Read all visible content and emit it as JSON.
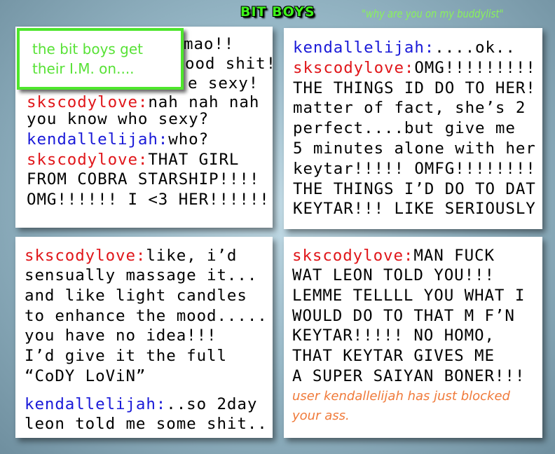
{
  "header": {
    "title": "BIT BOYS",
    "tagline": "\"why are you on my buddylist\""
  },
  "caption": {
    "line1": "the bit boys get",
    "line2": "their I.M. on...."
  },
  "panel1": {
    "partial": [
      "mao!!",
      "ood shit!",
      "e sexy!"
    ],
    "lines": [
      {
        "user": "skscodylove:",
        "text": "nah nah nah"
      },
      {
        "user": "",
        "text": "you know who sexy?"
      },
      {
        "user": "kendallelijah:",
        "text": "who?"
      },
      {
        "user": "skscodylove:",
        "text": "THAT GIRL"
      },
      {
        "user": "",
        "text": "FROM COBRA STARSHIP!!!!"
      },
      {
        "user": "",
        "text": "OMG!!!!!! I <3 HER!!!!!!"
      }
    ]
  },
  "panel2": {
    "lines": [
      {
        "user": "kendallelijah:",
        "text": "....ok.."
      },
      {
        "user": "skscodylove:",
        "text": "OMG!!!!!!!!!"
      },
      {
        "user": "",
        "text": "THE THINGS ID DO TO HER!"
      },
      {
        "user": "",
        "text": "matter of fact, she’s 2"
      },
      {
        "user": "",
        "text": "perfect....but give me"
      },
      {
        "user": "",
        "text": "5 minutes alone with her"
      },
      {
        "user": "",
        "text": "keytar!!!!! OMFG!!!!!!!!"
      },
      {
        "user": "",
        "text": "THE THINGS I’D DO TO DAT"
      },
      {
        "user": "",
        "text": "KEYTAR!!! LIKE SERIOUSLY"
      }
    ]
  },
  "panel3": {
    "lines": [
      {
        "user": "skscodylove:",
        "text": "like, i’d"
      },
      {
        "user": "",
        "text": "sensually massage it..."
      },
      {
        "user": "",
        "text": "and like light candles"
      },
      {
        "user": "",
        "text": "to enhance the mood....."
      },
      {
        "user": "",
        "text": "you have no idea!!!"
      },
      {
        "user": "",
        "text": "I’d give it the full"
      },
      {
        "user": "",
        "text": "“CoDY LoViN”"
      },
      {
        "user": "kendallelijah:",
        "text": "..so 2day"
      },
      {
        "user": "",
        "text": "leon told me some shit.."
      }
    ]
  },
  "panel4": {
    "lines": [
      {
        "user": "skscodylove:",
        "text": "MAN FUCK"
      },
      {
        "user": "",
        "text": "WAT LEON TOLD YOU!!!"
      },
      {
        "user": "",
        "text": "LEMME TELLLL YOU WHAT I"
      },
      {
        "user": "",
        "text": "WOULD DO TO THAT M F’N"
      },
      {
        "user": "",
        "text": "KEYTAR!!!!! NO HOMO,"
      },
      {
        "user": "",
        "text": "THAT KEYTAR GIVES ME"
      },
      {
        "user": "",
        "text": "A SUPER SAIYAN BONER!!!"
      }
    ],
    "system": [
      "user kendallelijah has just blocked",
      "your ass."
    ]
  },
  "colors": {
    "skscodylove": "#e0161a",
    "kendallelijah": "#1a1ad8",
    "system": "#f07a3a",
    "caption": "#4ee62c"
  }
}
